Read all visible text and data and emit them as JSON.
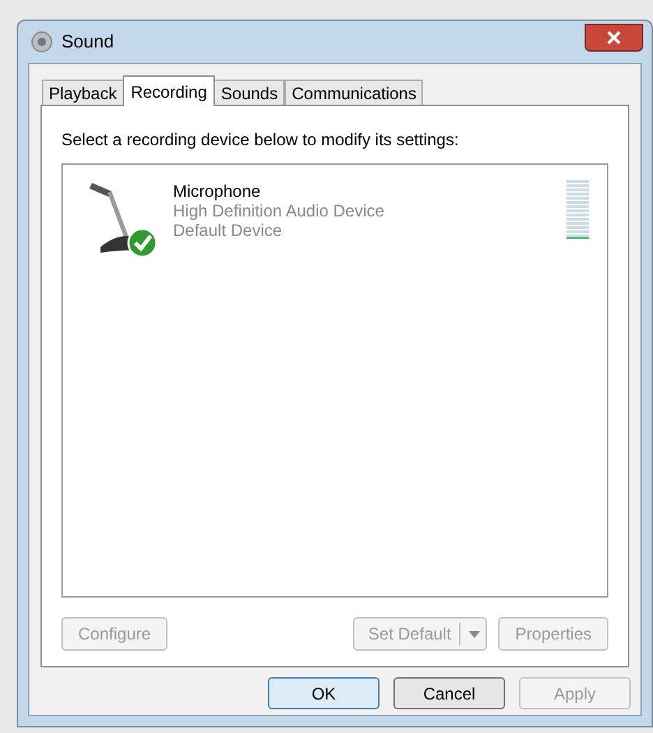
{
  "window": {
    "title": "Sound"
  },
  "tabs": [
    {
      "label": "Playback",
      "selected": false
    },
    {
      "label": "Recording",
      "selected": true
    },
    {
      "label": "Sounds",
      "selected": false
    },
    {
      "label": "Communications",
      "selected": false
    }
  ],
  "instruction": "Select a recording device below to modify its settings:",
  "devices": [
    {
      "name": "Microphone",
      "driver": "High Definition Audio Device",
      "status": "Default Device",
      "is_default": true,
      "selected": false,
      "level": 0
    }
  ],
  "device_buttons": [
    {
      "label": "Configure",
      "disabled": true,
      "kind": "plain"
    },
    {
      "label": "Set Default",
      "disabled": true,
      "kind": "split"
    },
    {
      "label": "Properties",
      "disabled": true,
      "kind": "plain"
    }
  ],
  "dialog_buttons": [
    {
      "label": "OK",
      "disabled": false,
      "default": true
    },
    {
      "label": "Cancel",
      "disabled": false,
      "default": false
    },
    {
      "label": "Apply",
      "disabled": true,
      "default": false
    }
  ]
}
